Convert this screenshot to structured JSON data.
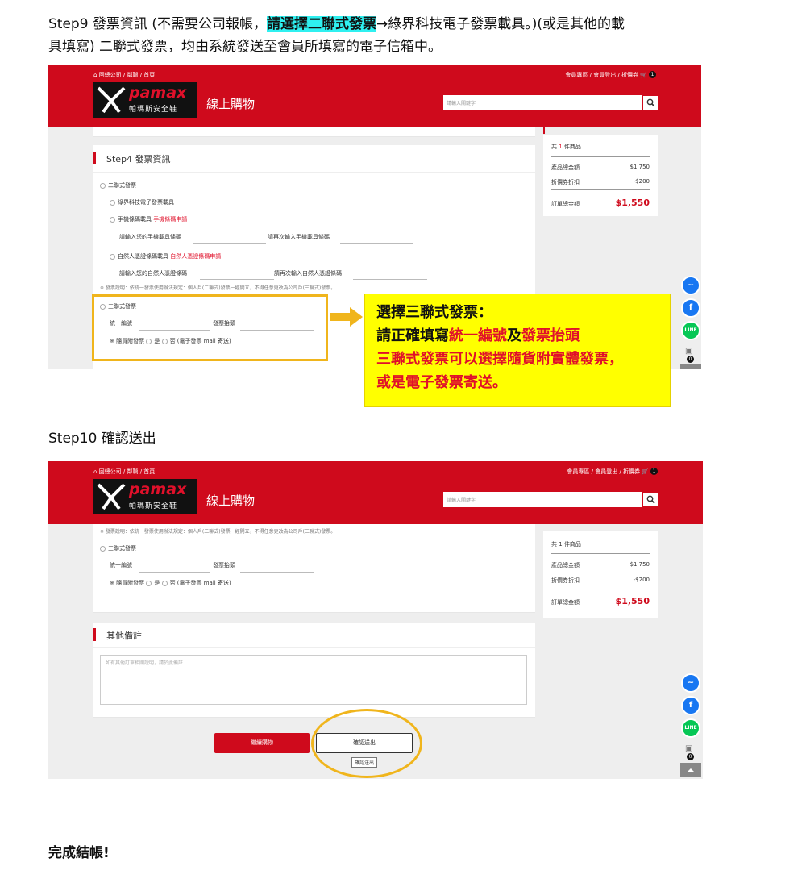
{
  "doc": {
    "step9_prefix": "Step9  發票資訊    (不需要公司報帳，",
    "step9_highlight": "請選擇二聯式發票",
    "step9_suffix": "→綠界科技電子發票載具。)(或是其他的載",
    "step9_line2": "具填寫)    二聯式發票，均由系統發送至會員所填寫的電子信箱中。",
    "step10": "Step10  確認送出",
    "done": "完成結帳!"
  },
  "site": {
    "breadcrumb": "回總公司 / 鄰鞝 / 首頁",
    "member_area": "會員專區",
    "logout": "會員登出",
    "coupon": "折價券",
    "cart_count": "1",
    "logo_en": "pamax",
    "logo_cn": "帕瑪斯安全鞋",
    "title": "線上購物",
    "search_placeholder": "請輸入關鍵字"
  },
  "invoice": {
    "step_title": "Step4 發票資訊",
    "two_part": "二聯式發票",
    "ecpay_carrier": "綠界科技電子發票載具",
    "mobile_carrier": "手機條碼載具",
    "mobile_apply": "手機條碼申請",
    "mobile_input": "請輸入您的手機載具條碼",
    "mobile_confirm": "請再次輸入手機載具條碼",
    "citizen_carrier": "自然人憑證條碼載具",
    "citizen_apply": "自然人憑證條碼申請",
    "citizen_input": "請輸入您的自然人憑證條碼",
    "citizen_confirm": "請再次輸入自然人憑證條碼",
    "note": "※ 發票說明：依統一發票使用辦法規定：個人戶(二聯式)發票一經開立，不得任意更改為公司戶(三聯式)發票。",
    "three_part": "三聯式發票",
    "tax_id": "統一編號",
    "invoice_title": "發票抬頭",
    "paper_label": "※ 隨貨附發票",
    "yes": "是",
    "no": "否 (電子發票 mail 寄送)"
  },
  "summary": {
    "count_prefix": "共",
    "count": "1",
    "count_suffix": "件商品",
    "subtotal_label": "產品總金額",
    "subtotal": "$1,750",
    "coupon_label": "折價券折扣",
    "coupon": "-$200",
    "total_label": "訂單總金額",
    "total": "$1,550"
  },
  "callout": {
    "line1": "選擇三聯式發票：",
    "line2_a": "請正確填寫",
    "line2_b": "統一編號",
    "line2_c": "及",
    "line2_d": "發票抬頭",
    "line3": "三聯式發票可以選擇隨貨附實體發票，",
    "line4": "或是電子發票寄送。"
  },
  "remarks": {
    "title": "其他備註",
    "placeholder": "如有其他訂單相關說明，請於此備註"
  },
  "buttons": {
    "continue": "繼續購物",
    "submit": "確認送出",
    "tooltip": "確認送出"
  },
  "side": {
    "badge": "0",
    "line": "LINE"
  },
  "colors": {
    "brand_red": "#cf0a1c",
    "highlight_yellow": "#ffff00",
    "callout_orange": "#f0b51c"
  }
}
